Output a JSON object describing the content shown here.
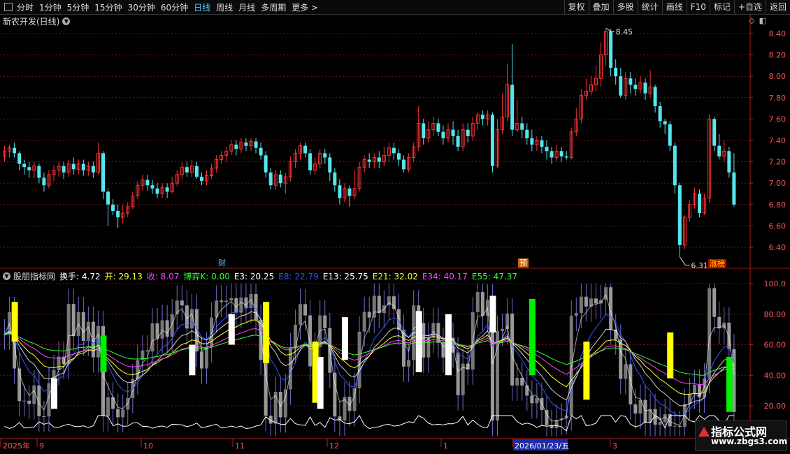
{
  "toolbar": {
    "periods": [
      "分时",
      "1分钟",
      "5分钟",
      "15分钟",
      "30分钟",
      "60分钟",
      "日线",
      "周线",
      "月线",
      "多周期",
      "更多 >"
    ],
    "active_index": 6,
    "buttons": [
      "复权",
      "叠加",
      "多股",
      "统计",
      "画线",
      "F10",
      "标记",
      "+自选",
      "返回"
    ]
  },
  "main_chart": {
    "title": "新农开发(日线)",
    "y_ticks": [
      "8.40",
      "8.20",
      "8.00",
      "7.80",
      "7.60",
      "7.40",
      "7.20",
      "7.00",
      "6.80",
      "6.60",
      "6.40"
    ],
    "high_label": "8.45",
    "low_label": "6.31",
    "badges": {
      "cai": "财",
      "yu": "预",
      "zhangbang": "涨榜"
    }
  },
  "sub_chart": {
    "name": "股朋指标网",
    "indicators": [
      {
        "label": "换手: 4.72",
        "color": "#ffffff"
      },
      {
        "label": "开: 29.13",
        "color": "#ffff33"
      },
      {
        "label": "收: 8.07",
        "color": "#ff44ff"
      },
      {
        "label": "博弈K: 0.00",
        "color": "#33ff33"
      },
      {
        "label": "E3: 20.25",
        "color": "#ffffff"
      },
      {
        "label": "E8: 22.79",
        "color": "#3355ff"
      },
      {
        "label": "E13: 25.75",
        "color": "#ffffff"
      },
      {
        "label": "E21: 32.02",
        "color": "#ffff33"
      },
      {
        "label": "E34: 40.17",
        "color": "#ff44ff"
      },
      {
        "label": "E55: 47.37",
        "color": "#33ff33"
      }
    ],
    "y_ticks": [
      "100.0",
      "80.00",
      "60.00",
      "40.00",
      "20.00"
    ]
  },
  "x_axis": {
    "labels": [
      "2025年",
      "9",
      "10",
      "11",
      "12",
      "1",
      "2026/01/23/五",
      "3"
    ]
  },
  "watermark": {
    "line1": "指标公式网",
    "line2": "www.zbgs3.com"
  },
  "colors": {
    "up": "#ff3333",
    "down": "#55e6ee",
    "grid": "#7a1010",
    "axis": "#b02020"
  },
  "chart_data": {
    "type": "candlestick",
    "title": "新农开发(日线)",
    "ylim": [
      6.31,
      8.45
    ],
    "candles": [
      [
        7.25,
        7.3,
        7.35,
        7.2
      ],
      [
        7.3,
        7.33,
        7.36,
        7.24
      ],
      [
        7.33,
        7.28,
        7.38,
        7.24
      ],
      [
        7.28,
        7.18,
        7.3,
        7.12
      ],
      [
        7.18,
        7.15,
        7.22,
        7.08
      ],
      [
        7.15,
        7.12,
        7.2,
        7.05
      ],
      [
        7.12,
        7.16,
        7.2,
        7.05
      ],
      [
        7.16,
        7.05,
        7.18,
        7.0
      ],
      [
        7.05,
        6.98,
        7.1,
        6.92
      ],
      [
        6.98,
        7.08,
        7.12,
        6.95
      ],
      [
        7.08,
        7.12,
        7.17,
        7.02
      ],
      [
        7.12,
        7.16,
        7.2,
        7.06
      ],
      [
        7.16,
        7.1,
        7.2,
        7.04
      ],
      [
        7.1,
        7.18,
        7.22,
        7.06
      ],
      [
        7.18,
        7.13,
        7.24,
        7.08
      ],
      [
        7.13,
        7.18,
        7.22,
        7.08
      ],
      [
        7.18,
        7.12,
        7.22,
        7.07
      ],
      [
        7.12,
        7.16,
        7.2,
        7.07
      ],
      [
        7.16,
        7.1,
        7.2,
        7.05
      ],
      [
        7.1,
        7.28,
        7.38,
        7.08
      ],
      [
        7.28,
        6.92,
        7.3,
        6.85
      ],
      [
        6.92,
        6.8,
        6.95,
        6.6
      ],
      [
        6.8,
        6.74,
        6.85,
        6.7
      ],
      [
        6.74,
        6.68,
        6.8,
        6.58
      ],
      [
        6.68,
        6.72,
        6.8,
        6.62
      ],
      [
        6.72,
        6.78,
        6.82,
        6.68
      ],
      [
        6.78,
        6.88,
        6.92,
        6.76
      ],
      [
        6.88,
        6.98,
        7.02,
        6.85
      ],
      [
        6.98,
        7.03,
        7.08,
        6.93
      ],
      [
        7.03,
        6.98,
        7.08,
        6.93
      ],
      [
        6.98,
        6.95,
        7.03,
        6.9
      ],
      [
        6.95,
        6.9,
        7.0,
        6.86
      ],
      [
        6.9,
        6.96,
        7.0,
        6.86
      ],
      [
        6.96,
        6.92,
        7.0,
        6.86
      ],
      [
        6.92,
        7.0,
        7.06,
        6.9
      ],
      [
        7.0,
        7.08,
        7.12,
        6.97
      ],
      [
        7.08,
        7.15,
        7.2,
        7.04
      ],
      [
        7.15,
        7.1,
        7.2,
        7.06
      ],
      [
        7.1,
        7.16,
        7.22,
        7.06
      ],
      [
        7.16,
        7.06,
        7.2,
        7.04
      ],
      [
        7.06,
        7.02,
        7.1,
        6.98
      ],
      [
        7.02,
        7.07,
        7.12,
        6.98
      ],
      [
        7.07,
        7.14,
        7.18,
        7.04
      ],
      [
        7.14,
        7.22,
        7.26,
        7.1
      ],
      [
        7.22,
        7.26,
        7.3,
        7.18
      ],
      [
        7.26,
        7.3,
        7.34,
        7.2
      ],
      [
        7.3,
        7.36,
        7.4,
        7.26
      ],
      [
        7.36,
        7.32,
        7.4,
        7.26
      ],
      [
        7.32,
        7.38,
        7.42,
        7.28
      ],
      [
        7.38,
        7.35,
        7.42,
        7.3
      ],
      [
        7.35,
        7.39,
        7.42,
        7.3
      ],
      [
        7.39,
        7.33,
        7.42,
        7.28
      ],
      [
        7.33,
        7.26,
        7.38,
        7.22
      ],
      [
        7.26,
        7.1,
        7.3,
        7.05
      ],
      [
        7.1,
        6.98,
        7.14,
        6.94
      ],
      [
        6.98,
        7.08,
        7.12,
        6.94
      ],
      [
        7.08,
        7.0,
        7.12,
        6.96
      ],
      [
        7.0,
        7.06,
        7.1,
        6.9
      ],
      [
        7.06,
        7.2,
        7.25,
        7.02
      ],
      [
        7.2,
        7.28,
        7.32,
        7.14
      ],
      [
        7.28,
        7.35,
        7.38,
        7.22
      ],
      [
        7.35,
        7.28,
        7.38,
        7.24
      ],
      [
        7.28,
        7.12,
        7.32,
        7.08
      ],
      [
        7.12,
        7.18,
        7.24,
        7.08
      ],
      [
        7.18,
        7.28,
        7.32,
        7.14
      ],
      [
        7.28,
        7.24,
        7.32,
        7.18
      ],
      [
        7.24,
        7.1,
        7.28,
        7.02
      ],
      [
        7.1,
        6.98,
        7.14,
        6.92
      ],
      [
        6.98,
        6.86,
        7.04,
        6.8
      ],
      [
        6.86,
        6.95,
        7.0,
        6.82
      ],
      [
        6.95,
        6.88,
        6.98,
        6.78
      ],
      [
        6.88,
        6.95,
        7.12,
        6.85
      ],
      [
        6.95,
        7.15,
        7.2,
        6.92
      ],
      [
        7.15,
        7.22,
        7.26,
        7.1
      ],
      [
        7.22,
        7.2,
        7.28,
        7.14
      ],
      [
        7.2,
        7.24,
        7.28,
        7.14
      ],
      [
        7.24,
        7.2,
        7.3,
        7.14
      ],
      [
        7.2,
        7.26,
        7.34,
        7.16
      ],
      [
        7.26,
        7.33,
        7.38,
        7.2
      ],
      [
        7.33,
        7.28,
        7.38,
        7.22
      ],
      [
        7.28,
        7.22,
        7.32,
        7.16
      ],
      [
        7.22,
        7.13,
        7.26,
        7.1
      ],
      [
        7.13,
        7.24,
        7.28,
        7.1
      ],
      [
        7.24,
        7.34,
        7.38,
        7.2
      ],
      [
        7.34,
        7.56,
        7.72,
        7.3
      ],
      [
        7.56,
        7.42,
        7.6,
        7.36
      ],
      [
        7.42,
        7.5,
        7.58,
        7.38
      ],
      [
        7.5,
        7.56,
        7.62,
        7.44
      ],
      [
        7.56,
        7.48,
        7.6,
        7.44
      ],
      [
        7.48,
        7.42,
        7.54,
        7.36
      ],
      [
        7.42,
        7.5,
        7.56,
        7.38
      ],
      [
        7.5,
        7.44,
        7.58,
        7.36
      ],
      [
        7.44,
        7.34,
        7.5,
        7.3
      ],
      [
        7.34,
        7.5,
        7.56,
        7.3
      ],
      [
        7.5,
        7.44,
        7.56,
        7.38
      ],
      [
        7.44,
        7.56,
        7.62,
        7.4
      ],
      [
        7.56,
        7.64,
        7.66,
        7.5
      ],
      [
        7.64,
        7.6,
        7.68,
        7.54
      ],
      [
        7.6,
        7.64,
        7.68,
        7.54
      ],
      [
        7.64,
        7.16,
        7.66,
        7.1
      ],
      [
        7.16,
        7.5,
        7.6,
        7.14
      ],
      [
        7.5,
        7.62,
        7.84,
        7.46
      ],
      [
        7.62,
        7.92,
        8.12,
        7.58
      ],
      [
        7.92,
        7.5,
        8.3,
        7.44
      ],
      [
        7.5,
        7.56,
        7.78,
        7.48
      ],
      [
        7.56,
        7.5,
        7.62,
        7.42
      ],
      [
        7.5,
        7.42,
        7.56,
        7.36
      ],
      [
        7.42,
        7.36,
        7.5,
        7.3
      ],
      [
        7.36,
        7.4,
        7.44,
        7.3
      ],
      [
        7.4,
        7.34,
        7.44,
        7.28
      ],
      [
        7.34,
        7.3,
        7.4,
        7.22
      ],
      [
        7.3,
        7.24,
        7.34,
        7.18
      ],
      [
        7.24,
        7.3,
        7.36,
        7.2
      ],
      [
        7.3,
        7.25,
        7.34,
        7.2
      ],
      [
        7.25,
        7.24,
        7.3,
        7.22
      ],
      [
        7.24,
        7.48,
        7.52,
        7.22
      ],
      [
        7.48,
        7.6,
        7.7,
        7.44
      ],
      [
        7.6,
        7.82,
        7.88,
        7.56
      ],
      [
        7.82,
        7.86,
        7.98,
        7.78
      ],
      [
        7.86,
        7.92,
        8.0,
        7.82
      ],
      [
        7.92,
        7.98,
        8.1,
        7.86
      ],
      [
        7.98,
        8.2,
        8.32,
        7.9
      ],
      [
        8.2,
        8.42,
        8.45,
        8.1
      ],
      [
        8.42,
        8.08,
        8.44,
        8.0
      ],
      [
        8.08,
        8.0,
        8.16,
        7.92
      ],
      [
        8.0,
        7.82,
        8.08,
        7.8
      ],
      [
        7.82,
        7.98,
        8.04,
        7.78
      ],
      [
        7.98,
        7.92,
        8.04,
        7.84
      ],
      [
        7.92,
        7.88,
        7.98,
        7.82
      ],
      [
        7.88,
        7.94,
        8.0,
        7.84
      ],
      [
        7.94,
        7.84,
        7.98,
        7.78
      ],
      [
        7.84,
        7.9,
        8.06,
        7.8
      ],
      [
        7.9,
        7.72,
        7.92,
        7.66
      ],
      [
        7.72,
        7.58,
        7.76,
        7.52
      ],
      [
        7.58,
        7.55,
        7.6,
        7.46
      ],
      [
        7.55,
        7.35,
        7.58,
        7.3
      ],
      [
        7.35,
        6.98,
        7.38,
        6.9
      ],
      [
        6.98,
        6.42,
        7.0,
        6.31
      ],
      [
        6.42,
        6.68,
        6.7,
        6.38
      ],
      [
        6.68,
        6.8,
        6.84,
        6.64
      ],
      [
        6.8,
        6.9,
        6.96,
        6.76
      ],
      [
        6.9,
        6.72,
        6.94,
        6.68
      ],
      [
        6.72,
        6.86,
        6.9,
        6.7
      ],
      [
        6.86,
        7.6,
        7.64,
        6.82
      ],
      [
        7.6,
        7.35,
        7.62,
        7.3
      ],
      [
        7.35,
        7.25,
        7.46,
        7.22
      ],
      [
        7.25,
        7.3,
        7.4,
        7.2
      ],
      [
        7.3,
        7.1,
        7.34,
        7.05
      ],
      [
        7.1,
        6.8,
        7.28,
        6.78
      ]
    ]
  }
}
